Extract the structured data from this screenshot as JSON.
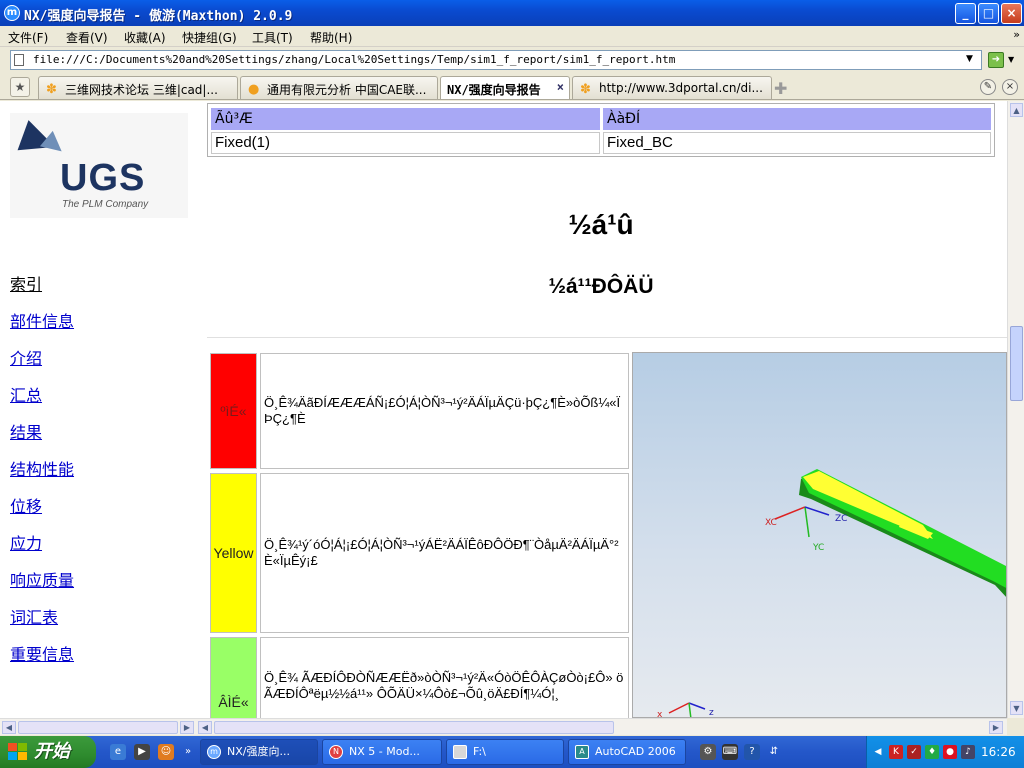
{
  "window": {
    "title": "NX/强度向导报告 - 傲游(Maxthon) 2.0.9",
    "icon_letter": "m",
    "min": "_",
    "max": "□",
    "close": "×"
  },
  "menu": [
    "文件(F)",
    "查看(V)",
    "收藏(A)",
    "快捷组(G)",
    "工具(T)",
    "帮助(H)"
  ],
  "address": {
    "url": "file:///C:/Documents%20and%20Settings/zhang/Local%20Settings/Temp/sim1_f_report/sim1_f_report.htm"
  },
  "tabs": [
    {
      "label": "三维网技术论坛 三维|cad|..."
    },
    {
      "label": "通用有限元分析 中国CAE联..."
    },
    {
      "label": "NX/强度向导报告"
    },
    {
      "label": "http://www.3dportal.cn/di..."
    }
  ],
  "logo": {
    "brand": "UGS",
    "tagline": "The PLM Company"
  },
  "nav": {
    "heading": "索引",
    "links": [
      "部件信息",
      "介绍",
      "汇总",
      "结果",
      "结构性能",
      "位移",
      "应力",
      "响应质量",
      "词汇表",
      "重要信息"
    ]
  },
  "top_table": {
    "headers": [
      "Ãû³Æ",
      "ÀàÐÍ"
    ],
    "row": [
      "Fixed(1)",
      "Fixed_BC"
    ]
  },
  "headings": {
    "h1": "½á¹û",
    "h2": "½á¹¹ÐÔÄÜ"
  },
  "legend": [
    {
      "label": "ºìÉ«",
      "color": "#ff0000",
      "text_color": "#7a1a1a",
      "desc": "Ö¸Ê¾ÄãÐÍÆÆÆÁÑ¡£Ó¦Á¦ÒÑ³¬¹ý²ÄÁÏµÄÇü·þÇ¿¶È»òÕß¼«ÏÞÇ¿¶È"
    },
    {
      "label": "Yellow",
      "color": "#ffff00",
      "text_color": "#222222",
      "desc": "Ö¸Ê¾¹ý´óÓ¦Á¦¡£Ó¦Á¦ÒÑ³¬¹ýÁË²ÄÁÏÊôÐÔÖÐ¶¨ÒåµÄ²ÄÁÏµÄ°²È«ÏµÊý¡£"
    },
    {
      "label": "ÂÌÉ«",
      "color": "#99ff66",
      "text_color": "#222222",
      "desc": "Ö¸Ê¾ ÃÆÐÍÔÐÒÑÆÆËð»òÒÑ³¬¹ý²Ä«ÓòÖÊÔÀÇøÒò¡£Ô» ö ÃÆÐÍÔªëµ½½á¹¹» ÔÕÄÜ×¼Ôò£¬Õû¸öÄ£ÐÍ¶¼Ó¦¸"
    }
  ],
  "render": {
    "axis_labels": [
      "XC",
      "YC",
      "ZC",
      "x",
      "z"
    ],
    "colors": {
      "beam": "#22dd22",
      "hot": "#ffff33",
      "edge": "#1a8a1a"
    }
  },
  "taskbar": {
    "start": "开始",
    "tasks": [
      "NX/强度向...",
      "NX 5 - Mod...",
      "F:\\",
      "AutoCAD 2006"
    ],
    "clock": "16:26"
  }
}
